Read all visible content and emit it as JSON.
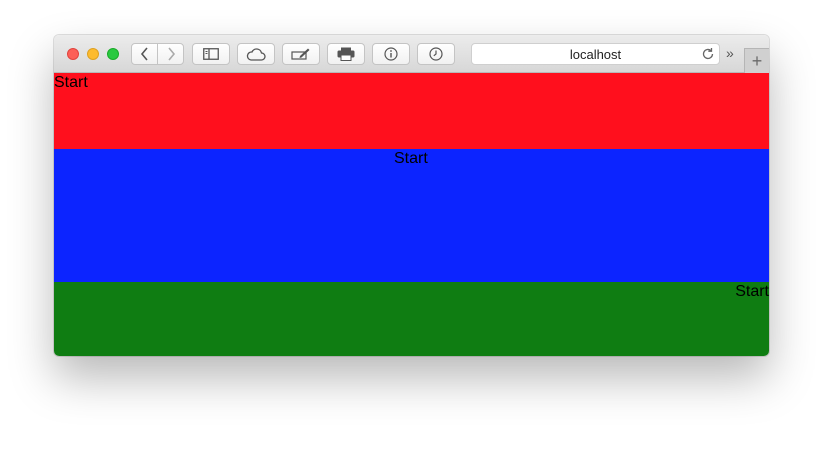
{
  "browser": {
    "url": "localhost",
    "icons": [
      "back-icon",
      "forward-icon",
      "sidebar-icon",
      "cloud-icon",
      "annotate-icon",
      "print-icon",
      "info-icon",
      "history-icon",
      "reload-icon",
      "overflow-icon",
      "plus-icon"
    ],
    "overflow_glyph": "»",
    "new_tab_glyph": "+"
  },
  "page": {
    "bands": [
      {
        "label": "Start",
        "color": "#ff0f1d",
        "align": "left"
      },
      {
        "label": "Start",
        "color": "#0c24ff",
        "align": "center"
      },
      {
        "label": "Start",
        "color": "#0f7d12",
        "align": "right"
      }
    ]
  }
}
